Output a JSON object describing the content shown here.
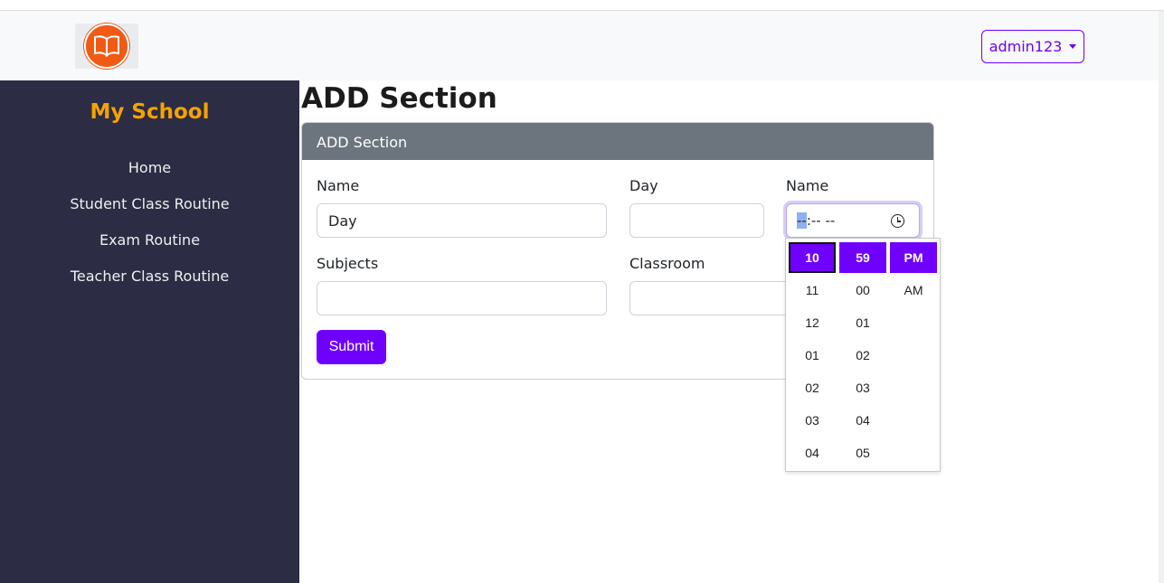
{
  "header": {
    "logo_icon": "open-book-icon",
    "user_label": "admin123"
  },
  "sidebar": {
    "brand": "My School",
    "items": [
      {
        "label": "Home"
      },
      {
        "label": "Student Class Routine"
      },
      {
        "label": "Exam Routine"
      },
      {
        "label": "Teacher Class Routine"
      }
    ]
  },
  "page": {
    "title": "ADD Section"
  },
  "form": {
    "card_title": "ADD Section",
    "name_label": "Name",
    "name_value": "Day",
    "day_label": "Day",
    "day_value": "",
    "time_label": "Name",
    "time_value_selected": "--",
    "time_value_rest": ":-- --",
    "subjects_label": "Subjects",
    "subjects_value": "",
    "classroom_label": "Classroom",
    "classroom_value": "",
    "submit_label": "Submit"
  },
  "time_picker": {
    "hours": [
      "10",
      "11",
      "12",
      "01",
      "02",
      "03",
      "04"
    ],
    "minutes": [
      "59",
      "00",
      "01",
      "02",
      "03",
      "04",
      "05"
    ],
    "periods": [
      "PM",
      "AM"
    ]
  },
  "colors": {
    "accent": "#6f00ff",
    "sidebar_bg": "#2c2c44",
    "brand": "#f5a300",
    "card_header": "#6c757d"
  }
}
